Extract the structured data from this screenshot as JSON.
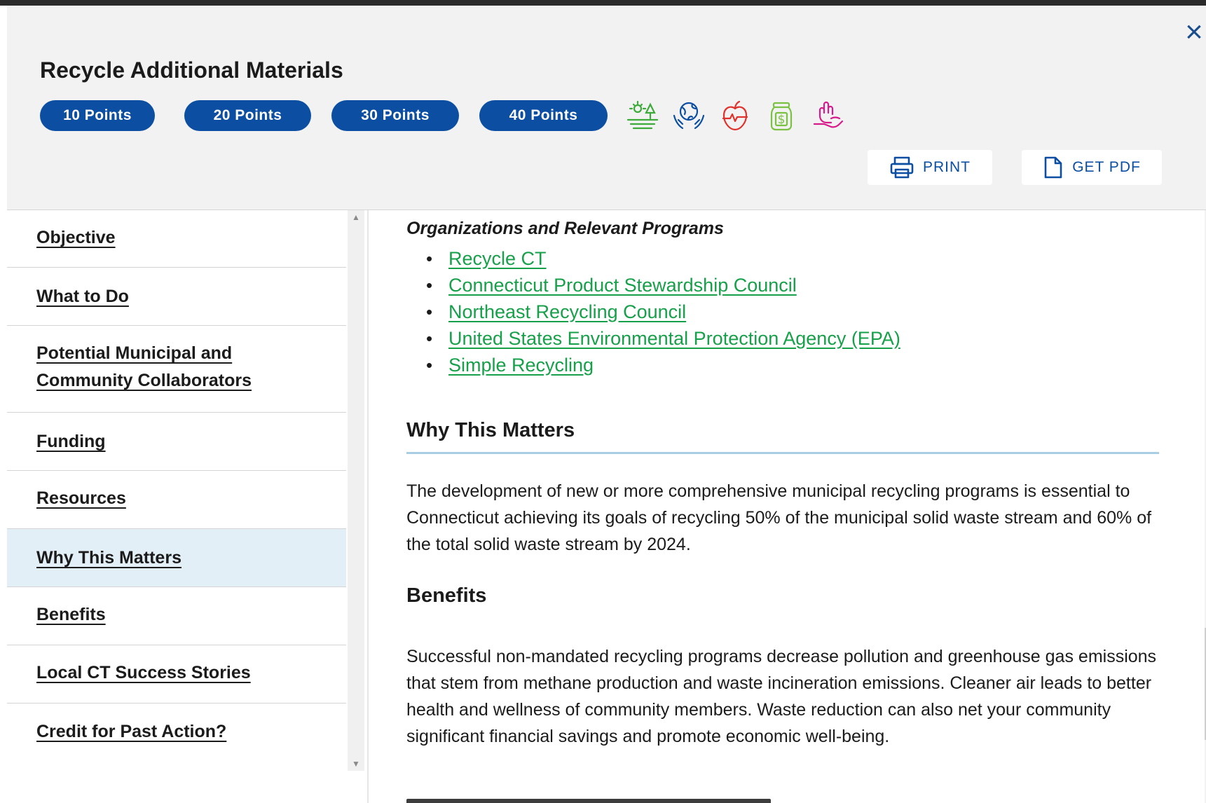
{
  "modal": {
    "title": "Recycle Additional Materials",
    "close_icon": "close-icon",
    "points": [
      "10 Points",
      "20 Points",
      "30 Points",
      "40 Points"
    ],
    "category_icons": [
      {
        "name": "landscape-trees-icon",
        "color": "#3cab3a"
      },
      {
        "name": "globe-hands-icon",
        "color": "#0b4ea2"
      },
      {
        "name": "apple-heartbeat-icon",
        "color": "#e0312d"
      },
      {
        "name": "money-jar-icon",
        "color": "#7cc242"
      },
      {
        "name": "helping-hand-icon",
        "color": "#d81b8c"
      }
    ],
    "print_label": "PRINT",
    "pdf_label": "GET PDF"
  },
  "sidebar": {
    "items": [
      {
        "label": "Objective"
      },
      {
        "label": "What to Do"
      },
      {
        "label_lines": [
          "Potential Municipal and",
          "Community Collaborators"
        ]
      },
      {
        "label": "Funding"
      },
      {
        "label": "Resources"
      },
      {
        "label": "Why This Matters",
        "active": true
      },
      {
        "label": "Benefits"
      },
      {
        "label": "Local CT Success Stories"
      },
      {
        "label": "Credit for Past Action?"
      }
    ]
  },
  "content": {
    "org_heading": "Organizations and Relevant Programs",
    "links": [
      "Recycle CT",
      "Connecticut Product Stewardship Council",
      "Northeast Recycling Council",
      "United States Environmental Protection Agency (EPA)",
      "Simple Recycling"
    ],
    "why_heading": "Why This Matters",
    "why_text": "The development of new or more comprehensive municipal recycling programs is essential to Connecticut achieving its goals of recycling 50% of the municipal solid waste stream and 60% of the total solid waste stream by 2024.",
    "benefits_heading": "Benefits",
    "benefits_text": "Successful non-mandated recycling programs decrease pollution and greenhouse gas emissions that stem from methane production and waste incineration emissions. Cleaner air leads to better health and wellness of community members. Waste reduction can also net your community significant financial savings and promote economic well-being."
  },
  "colors": {
    "accent": "#0b4ea2",
    "link": "#17a04a",
    "active_nav": "#e3eff7",
    "rule": "#a9cde2"
  }
}
